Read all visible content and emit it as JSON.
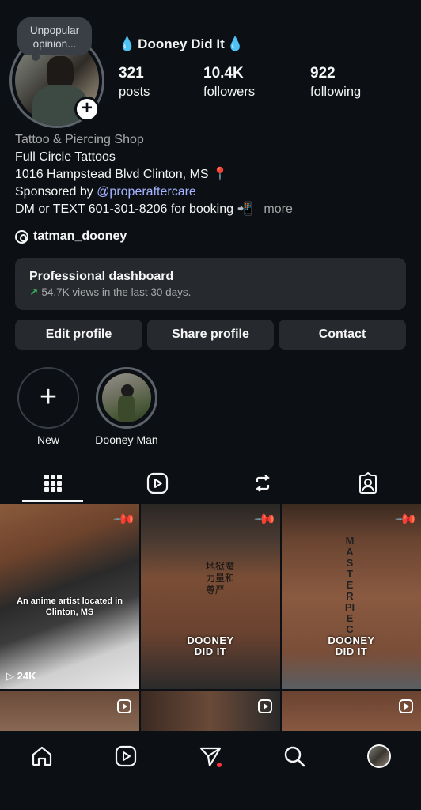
{
  "colors": {
    "background": "#0c1014",
    "card": "#262a2f",
    "link": "#a6b4ff",
    "trend": "#38b35b",
    "notification": "#ff3040",
    "drop": "#e0242b"
  },
  "profile": {
    "note": "Unpopular opinion...",
    "name": "Dooney Did It",
    "stats": [
      {
        "value": "321",
        "label": "posts"
      },
      {
        "value": "10.4K",
        "label": "followers"
      },
      {
        "value": "922",
        "label": "following"
      }
    ]
  },
  "bio": {
    "category": "Tattoo & Piercing Shop",
    "line1": "Full Circle Tattoos",
    "line2": "1016 Hampstead Blvd Clinton, MS",
    "sponsor_prefix": "Sponsored by ",
    "sponsor_link": "@properaftercare",
    "line4": "DM or TEXT 601-301-8206 for booking",
    "more": "more"
  },
  "threads": {
    "handle": "tatman_dooney"
  },
  "dashboard": {
    "title": "Professional dashboard",
    "subtitle": "54.7K views in the last 30 days."
  },
  "buttons": {
    "edit": "Edit profile",
    "share": "Share profile",
    "contact": "Contact"
  },
  "highlights": [
    {
      "label": "New"
    },
    {
      "label": "Dooney Man"
    }
  ],
  "tabs": [
    {
      "icon": "grid-icon",
      "active": true
    },
    {
      "icon": "reels-icon",
      "active": false
    },
    {
      "icon": "reposts-icon",
      "active": false
    },
    {
      "icon": "tagged-icon",
      "active": false
    }
  ],
  "posts": [
    {
      "caption": "An anime artist located in Clinton, MS",
      "views": "24K",
      "pinned": true
    },
    {
      "overlay_text": "地狱魔力量和尊严",
      "watermark": "DOONEY DID IT",
      "pinned": true
    },
    {
      "overlay_text": "MASTERPIECE",
      "watermark": "DOONEY DID IT",
      "pinned": true
    }
  ],
  "bottom_nav": [
    {
      "icon": "home-icon"
    },
    {
      "icon": "reels-icon"
    },
    {
      "icon": "send-icon",
      "notification": true
    },
    {
      "icon": "search-icon"
    },
    {
      "icon": "profile-avatar"
    }
  ]
}
